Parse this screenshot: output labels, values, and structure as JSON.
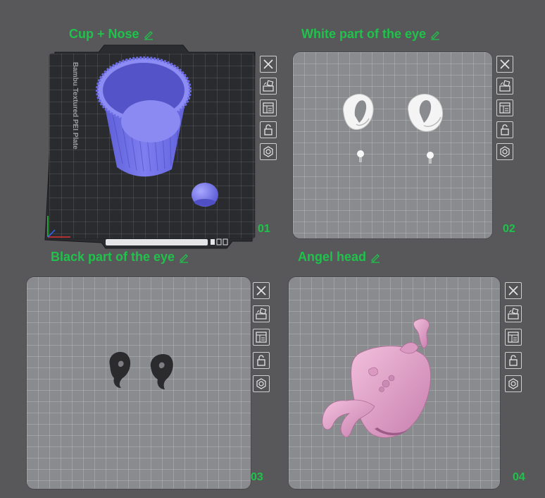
{
  "plates": [
    {
      "title": "Cup + Nose",
      "number": "01",
      "bed_label": "Bambu Textured PEI Plate"
    },
    {
      "title": "White part of the eye",
      "number": "02"
    },
    {
      "title": "Black part of the eye",
      "number": "03"
    },
    {
      "title": "Angel head",
      "number": "04"
    }
  ],
  "toolbar": {
    "buttons": [
      "close-icon",
      "auto-arrange-icon",
      "plate-settings-icon",
      "lock-icon",
      "orient-icon"
    ]
  },
  "colors": {
    "title_green": "#1fc24a",
    "cup_purple": "#7e7ef0",
    "eye_white": "#f4f4f4",
    "eye_black": "#2b2b2d",
    "head_pink": "#e7a9cf",
    "background": "#58585b"
  }
}
